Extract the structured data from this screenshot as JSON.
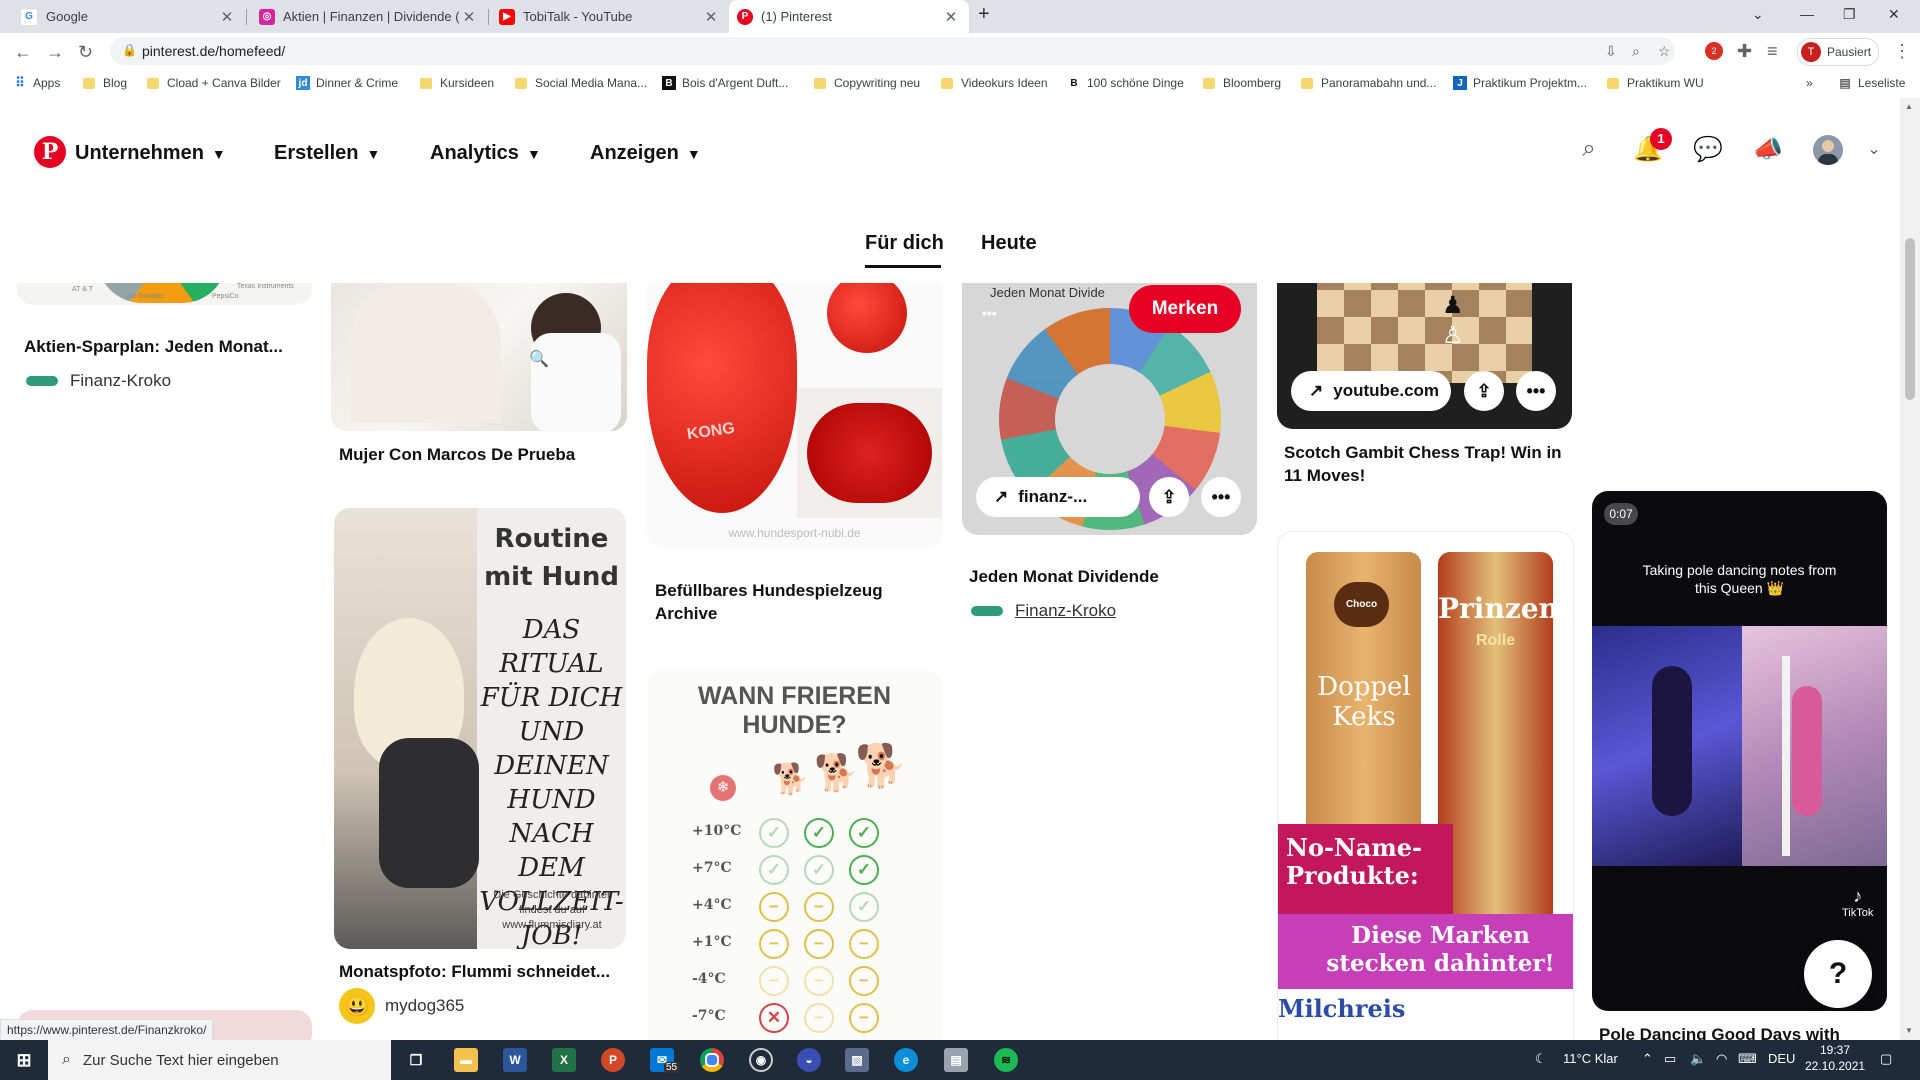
{
  "browser": {
    "tabs": [
      {
        "title": "Google",
        "icon": "google-icon"
      },
      {
        "title": "Aktien | Finanzen | Dividende (@",
        "icon": "instagram-icon"
      },
      {
        "title": "TobiTalk - YouTube",
        "icon": "youtube-icon"
      },
      {
        "title": "(1) Pinterest",
        "icon": "pinterest-icon",
        "active": true
      }
    ],
    "url": "pinterest.de/homefeed/",
    "profile_label": "Pausiert",
    "bookmarks": [
      "Apps",
      "Blog",
      "Cload + Canva Bilder",
      "Dinner & Crime",
      "Kursideen",
      "Social Media Mana...",
      "Bois d'Argent Duft...",
      "Copywriting neu",
      "Videokurs Ideen",
      "100 schöne Dinge",
      "Bloomberg",
      "Panoramabahn und...",
      "Praktikum Projektm...",
      "Praktikum WU"
    ],
    "reading_list": "Leseliste",
    "more": "»",
    "ext_badge": "2"
  },
  "header": {
    "nav": [
      "Unternehmen",
      "Erstellen",
      "Analytics",
      "Anzeigen"
    ],
    "notification_count": "1",
    "feed_tabs": [
      "Für dich",
      "Heute"
    ]
  },
  "pins": {
    "p1": {
      "title": "Aktien-Sparplan: Jeden Monat...",
      "creator": "Finanz-Kroko",
      "img_labels": [
        "AT & T",
        "Mc Donalds",
        "PepsiCo",
        "Texas Instruments"
      ]
    },
    "p2": {
      "title": "Mujer Con Marcos De Prueba"
    },
    "p3": {
      "title": "Monatspfoto: Flummi schneidet...",
      "creator": "mydog365",
      "img_title": "Routine mit Hund",
      "img_text": "DAS RITUAL FÜR DICH UND DEINEN HUND NACH DEM VOLLZEIT-JOB!",
      "img_note": "Die Geschichte dahinter findest du auf www.flummisdiary.at"
    },
    "p4": {
      "title": "Befüllbares Hundespielzeug Archive",
      "img_url": "www.hundesport-nubi.de",
      "img_brand": "KONG"
    },
    "p5": {
      "title": "WANN FRIEREN HUNDE?",
      "rows": [
        "+10°C",
        "+7°C",
        "+4°C",
        "+1°C",
        "-4°C",
        "-7°C"
      ],
      "states": [
        [
          "ok-light",
          "ok",
          "ok"
        ],
        [
          "ok-light",
          "ok-light",
          "ok"
        ],
        [
          "warn",
          "warn",
          "ok-light"
        ],
        [
          "warn",
          "warn",
          "warn"
        ],
        [
          "warn-light",
          "warn-light",
          "warn"
        ],
        [
          "bad",
          "warn-light",
          "warn"
        ]
      ]
    },
    "p6": {
      "title": "Jeden Monat Dividende",
      "creator": "Finanz-Kroko",
      "save_label": "Merken",
      "link_label": "finanz-...",
      "img_title": "Jeden Monat Divide"
    },
    "p7": {
      "title": "Scotch Gambit Chess Trap! Win in 11 Moves!",
      "link_label": "youtube.com"
    },
    "p8": {
      "overlay1": "No-Name-Produkte:",
      "overlay2": "Diese Marken stecken dahinter!",
      "brand1": "Doppel Keks",
      "brand2": "Prinzen",
      "brand2b": "Rolle",
      "brand3": "Milchreis"
    },
    "p9": {
      "duration": "0:07",
      "caption": "Taking pole dancing notes from this Queen 👑",
      "title": "Pole Dancing Good Days with",
      "brand": "TikTok"
    }
  },
  "help_label": "?",
  "status_url": "https://www.pinterest.de/Finanzkroko/",
  "taskbar": {
    "search_placeholder": "Zur Suche Text hier eingeben",
    "mail_badge": "55",
    "weather": "11°C  Klar",
    "lang": "DEU",
    "time": "19:37",
    "date": "22.10.2021"
  }
}
